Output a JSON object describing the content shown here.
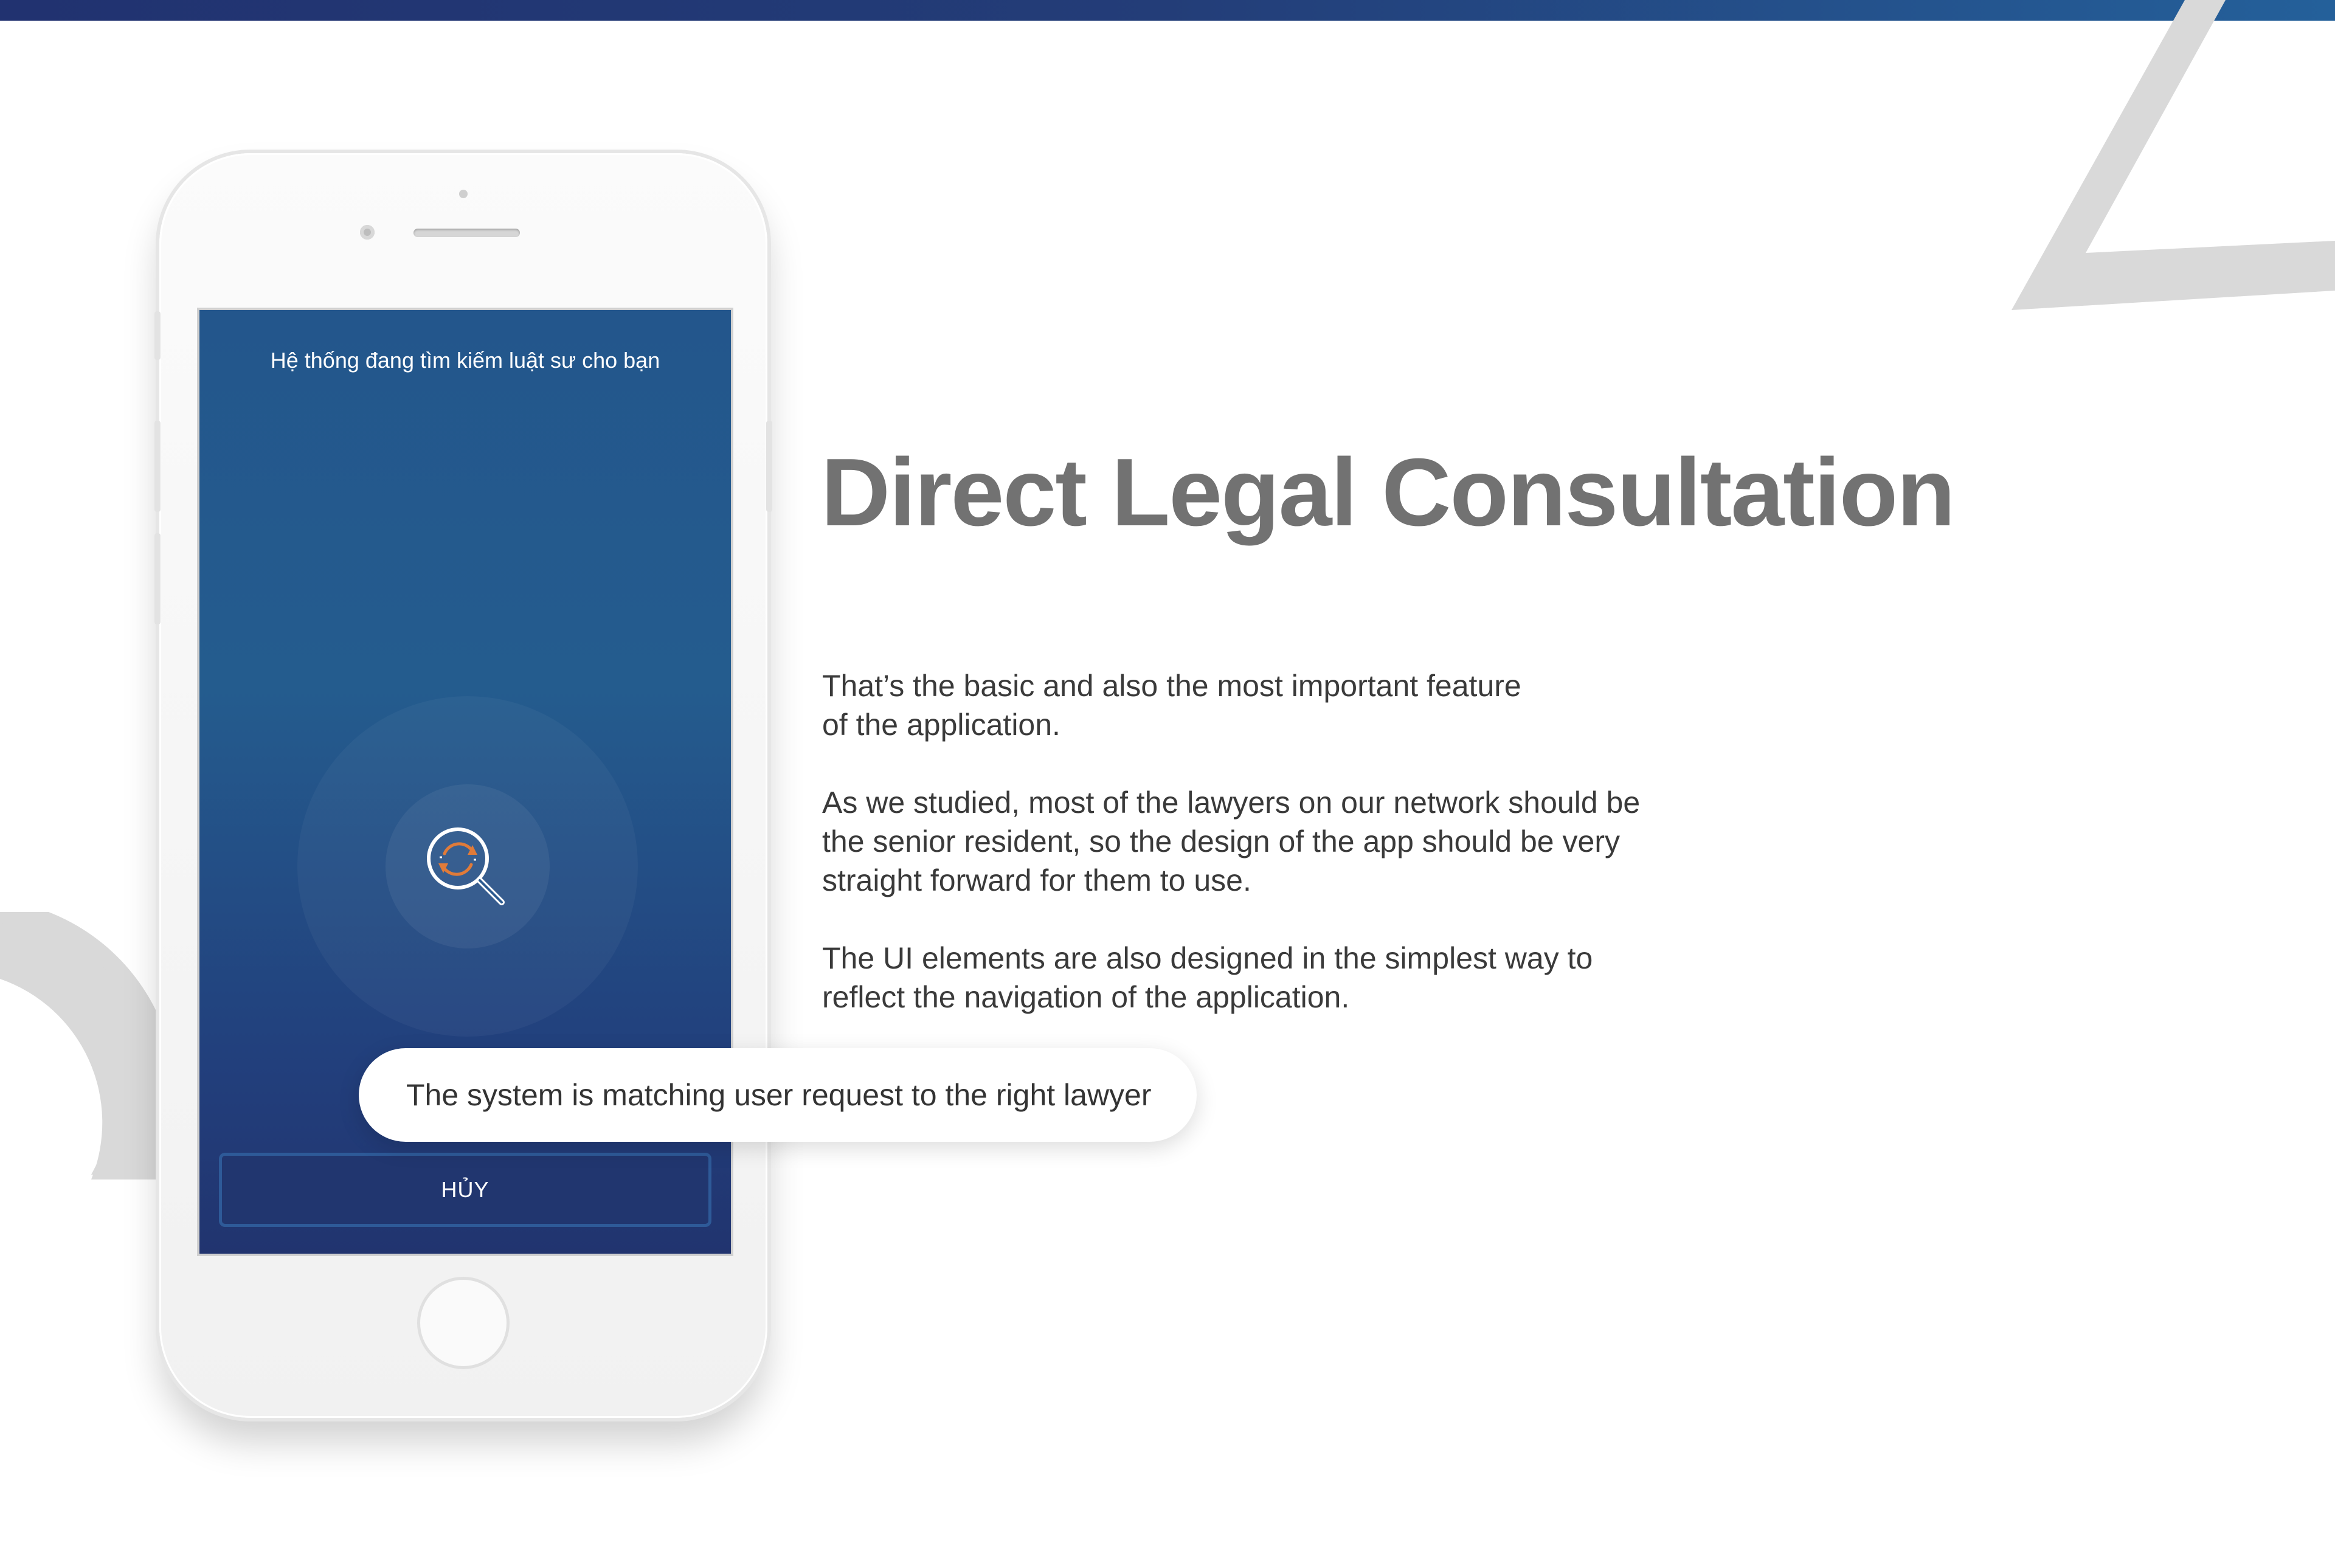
{
  "heading": {
    "title": "Direct Legal Consultation"
  },
  "paragraphs": [
    {
      "line1": "That’s the basic and also the most important feature",
      "line2": "of the application."
    },
    {
      "line1": "As we studied, most of the lawyers on our network should be",
      "line2": "the senior resident, so the design of the app should be very",
      "line3": "straight forward for them to use."
    },
    {
      "line1": "The UI elements are also designed in the simplest way to",
      "line2": "reflect the navigation of the application."
    }
  ],
  "phone_screen": {
    "status_text": "Hệ thống đang tìm kiếm luật sư cho bạn",
    "search_icon": "search-refresh-icon",
    "cancel_label": "HỦY"
  },
  "callout": {
    "text": "The system is matching user request to the right lawyer"
  },
  "colors": {
    "top_bar_start": "#213270",
    "top_bar_end": "#24609a",
    "screen_top": "#23568c",
    "screen_bottom": "#21346f",
    "title": "#727272",
    "body_text": "#3a3a3a",
    "icon_accent": "#e07b39",
    "decor": "#d9d9d9"
  }
}
